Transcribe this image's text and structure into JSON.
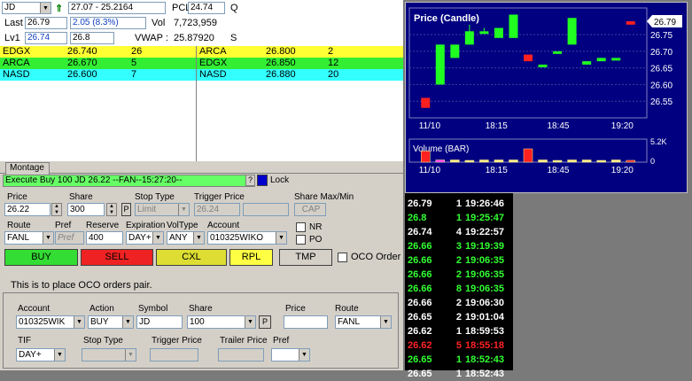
{
  "quote": {
    "symbol": "JD",
    "range": "27.07 - 25.2164",
    "pcl_label": "PCL",
    "pcl_value": "24.74",
    "q_label": "Q",
    "last_label": "Last",
    "last_value": "26.79",
    "change": "2.05  (8.3%)",
    "vol_label": "Vol",
    "vol_value": "7,723,959",
    "lv1_label": "Lv1",
    "lv1_bid": "26.74",
    "lv1_ask": "26.8",
    "vwap_label": "VWAP :",
    "vwap_value": "25.87920",
    "s_label": "S"
  },
  "book": {
    "bids": [
      {
        "mm": "EDGX",
        "price": "26.740",
        "size": "26",
        "color": "#ffff33"
      },
      {
        "mm": "ARCA",
        "price": "26.670",
        "size": "5",
        "color": "#33ee33"
      },
      {
        "mm": "NASD",
        "price": "26.600",
        "size": "7",
        "color": "#33ffff"
      }
    ],
    "asks": [
      {
        "mm": "ARCA",
        "price": "26.800",
        "size": "2",
        "color": "#ffff33"
      },
      {
        "mm": "EDGX",
        "price": "26.850",
        "size": "12",
        "color": "#33ee33"
      },
      {
        "mm": "NASD",
        "price": "26.880",
        "size": "20",
        "color": "#33ffff"
      }
    ]
  },
  "montage_tab": "Montage",
  "exec_text": "Execute Buy 100 JD 26.22 --FAN--15:27:20--",
  "help_label": "?",
  "lock_label": "Lock",
  "order": {
    "price_label": "Price",
    "price_value": "26.22",
    "share_label": "Share",
    "share_value": "300",
    "p_label": "P",
    "stop_type_label": "Stop Type",
    "stop_type_value": "Limit",
    "trigger_label": "Trigger Price",
    "trigger_value": "26.24",
    "share_max_label": "Share Max/Min",
    "cap_label": "CAP",
    "route_label": "Route",
    "route_value": "FANL",
    "pref_label": "Pref",
    "pref_value": "Pref",
    "reserve_label": "Reserve",
    "reserve_value": "400",
    "expiration_label": "Expiration",
    "expiration_value": "DAY+",
    "voltype_label": "VolType",
    "voltype_value": "ANY",
    "account_label": "Account",
    "account_value": "010325WIKO",
    "nr_label": "NR",
    "po_label": "PO"
  },
  "buttons": {
    "buy": "BUY",
    "sell": "SELL",
    "cxl": "CXL",
    "rpl": "RPL",
    "tmp": "TMP",
    "oco_label": "OCO Order"
  },
  "oco_note": "This is to place OCO orders pair.",
  "oco": {
    "account_label": "Account",
    "account_value": "010325WIK",
    "action_label": "Action",
    "action_value": "BUY",
    "symbol_label": "Symbol",
    "symbol_value": "JD",
    "share_label": "Share",
    "share_value": "100",
    "p_label": "P",
    "price_label": "Price",
    "price_value": "",
    "route_label": "Route",
    "route_value": "FANL",
    "tif_label": "TIF",
    "tif_value": "DAY+",
    "stop_type_label": "Stop Type",
    "trigger_label": "Trigger Price",
    "trailer_label": "Trailer Price",
    "pref_label": "Pref"
  },
  "chart_data": [
    {
      "type": "candlestick",
      "title": "Price (Candle)",
      "xlabel": "",
      "ylabel": "",
      "x_ticks": [
        "11/10",
        "18:15",
        "18:45",
        "19:20",
        "19:20"
      ],
      "x_tick_labels": [
        "11/10",
        "18:15",
        "18:45",
        "19:20"
      ],
      "y_ticks": [
        26.55,
        26.6,
        26.65,
        26.7,
        26.75
      ],
      "ylim": [
        26.5,
        26.83
      ],
      "last_price_label": "26.79",
      "candles": [
        {
          "open": 26.56,
          "close": 26.53,
          "high": 26.56,
          "low": 26.53,
          "color": "red"
        },
        {
          "open": 26.6,
          "close": 26.72,
          "high": 26.72,
          "low": 26.6,
          "color": "green"
        },
        {
          "open": 26.68,
          "close": 26.72,
          "high": 26.72,
          "low": 26.68,
          "color": "green"
        },
        {
          "open": 26.72,
          "close": 26.76,
          "high": 26.78,
          "low": 26.72,
          "color": "green"
        },
        {
          "open": 26.76,
          "close": 26.76,
          "high": 26.77,
          "low": 26.76,
          "color": "green"
        },
        {
          "open": 26.77,
          "close": 26.74,
          "high": 26.77,
          "low": 26.74,
          "color": "green"
        },
        {
          "open": 26.74,
          "close": 26.81,
          "high": 26.81,
          "low": 26.74,
          "color": "green"
        },
        {
          "open": 26.69,
          "close": 26.67,
          "high": 26.69,
          "low": 26.67,
          "color": "red"
        },
        {
          "open": 26.66,
          "close": 26.66,
          "high": 26.66,
          "low": 26.66,
          "color": "green"
        },
        {
          "open": 26.7,
          "close": 26.7,
          "high": 26.7,
          "low": 26.7,
          "color": "green"
        },
        {
          "open": 26.72,
          "close": 26.8,
          "high": 26.8,
          "low": 26.72,
          "color": "green"
        },
        {
          "open": 26.66,
          "close": 26.67,
          "high": 26.67,
          "low": 26.66,
          "color": "green"
        },
        {
          "open": 26.67,
          "close": 26.68,
          "high": 26.68,
          "low": 26.67,
          "color": "green"
        },
        {
          "open": 26.68,
          "close": 26.68,
          "high": 26.68,
          "low": 26.68,
          "color": "green"
        },
        {
          "open": 26.79,
          "close": 26.78,
          "high": 26.79,
          "low": 26.78,
          "color": "red"
        }
      ]
    },
    {
      "type": "bar",
      "title": "Volume (BAR)",
      "y_ticks": [
        "5.2K",
        "0"
      ],
      "values": [
        2.5,
        0.5,
        0.5,
        0.3,
        0.5,
        0.5,
        0.5,
        3.0,
        0.5,
        0.3,
        0.5,
        0.5,
        0.3,
        0.5,
        0.3
      ]
    }
  ],
  "time_sales": [
    {
      "price": "26.79",
      "size": "1",
      "time": "19:26:46",
      "color": "#ffffff"
    },
    {
      "price": "26.8",
      "size": "1",
      "time": "19:25:47",
      "color": "#33ff33"
    },
    {
      "price": "26.74",
      "size": "4",
      "time": "19:22:57",
      "color": "#ffffff"
    },
    {
      "price": "26.66",
      "size": "3",
      "time": "19:19:39",
      "color": "#33ff33"
    },
    {
      "price": "26.66",
      "size": "2",
      "time": "19:06:35",
      "color": "#33ff33"
    },
    {
      "price": "26.66",
      "size": "2",
      "time": "19:06:35",
      "color": "#33ff33"
    },
    {
      "price": "26.66",
      "size": "8",
      "time": "19:06:35",
      "color": "#33ff33"
    },
    {
      "price": "26.66",
      "size": "2",
      "time": "19:06:30",
      "color": "#ffffff"
    },
    {
      "price": "26.65",
      "size": "2",
      "time": "19:01:04",
      "color": "#ffffff"
    },
    {
      "price": "26.62",
      "size": "1",
      "time": "18:59:53",
      "color": "#ffffff"
    },
    {
      "price": "26.62",
      "size": "5",
      "time": "18:55:18",
      "color": "#ff2222"
    },
    {
      "price": "26.65",
      "size": "1",
      "time": "18:52:43",
      "color": "#33ff33"
    },
    {
      "price": "26.65",
      "size": "1",
      "time": "18:52:43",
      "color": "#ffffff"
    }
  ]
}
